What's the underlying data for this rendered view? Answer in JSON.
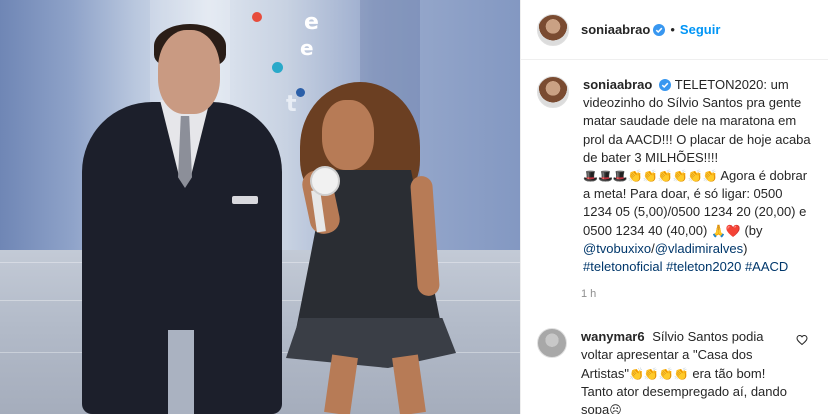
{
  "media": {
    "alt": "",
    "studio_letters": [
      "e",
      "e",
      "t"
    ]
  },
  "header": {
    "username": "soniaabrao",
    "separator": "•",
    "follow_label": "Seguir"
  },
  "caption": {
    "username": "soniaabrao",
    "text_1": "TELETON2020: um videozinho do Sílvio Santos pra gente matar saudade dele na maratona em prol da AACD!!! O placar de hoje acaba de bater 3 MILHÕES!!!!",
    "emoji_1": "🎩🎩🎩👏👏👏👏👏👏",
    "text_2": "Agora é dobrar a meta! Para doar, é só ligar: 0500 1234 05 (5,00)/0500 1234 20 (20,00) e 0500 1234 40 (40,00)",
    "emoji_2": "🙏❤️",
    "by_prefix": "(by",
    "mention_1": "@tvobuxixo",
    "slash": "/",
    "mention_2": "@vladimiralves",
    "by_suffix": ")",
    "hashtags": [
      "#teletonoficial",
      "#teleton2020",
      "#AACD"
    ],
    "time": "1 h"
  },
  "comment": {
    "username": "wanymar6",
    "text_1": "Sílvio Santos podia voltar apresentar a \"Casa dos Artistas\"",
    "emoji_1": "👏👏👏👏",
    "text_2": "era tão bom! Tanto ator desempregado aí, dando sopa",
    "emoji_2": "☹"
  },
  "colors": {
    "link": "#00376b",
    "follow": "#0095f6",
    "verified": "#3897f0",
    "muted": "#8e8e8e"
  },
  "icons": {
    "verified": "verified-badge-icon",
    "heart": "heart-outline-icon"
  }
}
